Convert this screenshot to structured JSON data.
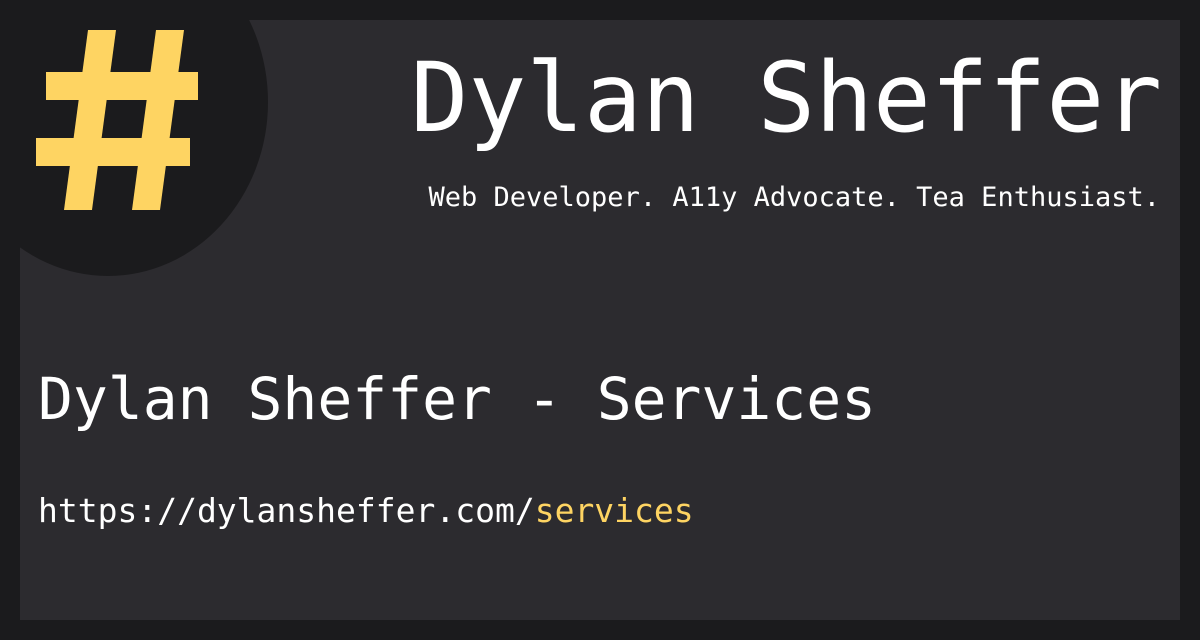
{
  "brand": {
    "logo_icon": "hash-icon",
    "logo_glyph": "#",
    "name": "Dylan Sheffer",
    "tagline": "Web Developer. A11y Advocate. Tea Enthusiast."
  },
  "page": {
    "title": "Dylan Sheffer - Services",
    "url_base": "https://dylansheffer.com/",
    "url_path": "services"
  },
  "colors": {
    "background": "#1b1b1d",
    "card": "#2c2b2f",
    "accent": "#fed462",
    "text": "#ffffff"
  }
}
